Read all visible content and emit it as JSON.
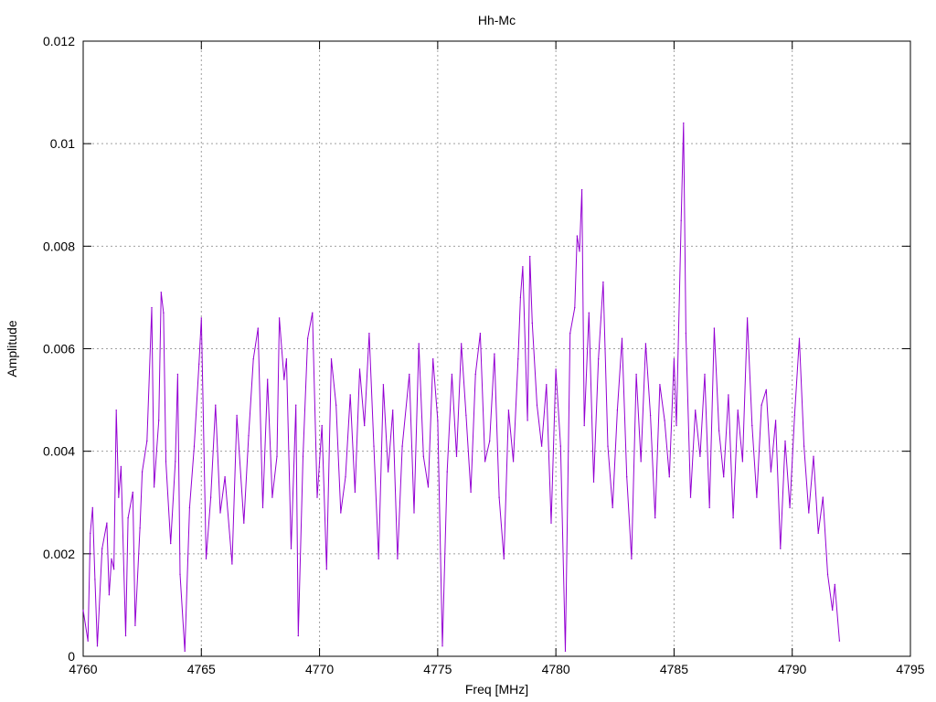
{
  "chart_data": {
    "type": "line",
    "title": "Hh-Mc",
    "xlabel": "Freq [MHz]",
    "ylabel": "Amplitude",
    "xlim": [
      4760,
      4795
    ],
    "ylim": [
      0,
      0.012
    ],
    "xticks": [
      4760,
      4765,
      4770,
      4775,
      4780,
      4785,
      4790,
      4795
    ],
    "yticks": [
      0,
      0.002,
      0.004,
      0.006,
      0.008,
      0.01,
      0.012
    ],
    "xtick_labels": [
      "4760",
      "4765",
      "4770",
      "4775",
      "4780",
      "4785",
      "4790",
      "4795"
    ],
    "ytick_labels": [
      "0",
      "0.002",
      "0.004",
      "0.006",
      "0.008",
      "0.01",
      "0.012"
    ],
    "grid": true,
    "series": [
      {
        "color": "#9400d3",
        "points": [
          [
            4760.0,
            0.0009
          ],
          [
            4760.2,
            0.0003
          ],
          [
            4760.3,
            0.0024
          ],
          [
            4760.4,
            0.0029
          ],
          [
            4760.5,
            0.0015
          ],
          [
            4760.6,
            0.0002
          ],
          [
            4760.8,
            0.0021
          ],
          [
            4761.0,
            0.0026
          ],
          [
            4761.1,
            0.0012
          ],
          [
            4761.2,
            0.0019
          ],
          [
            4761.3,
            0.0017
          ],
          [
            4761.4,
            0.0048
          ],
          [
            4761.5,
            0.0031
          ],
          [
            4761.6,
            0.0037
          ],
          [
            4761.8,
            0.0004
          ],
          [
            4761.9,
            0.0027
          ],
          [
            4762.1,
            0.0032
          ],
          [
            4762.2,
            0.0006
          ],
          [
            4762.4,
            0.0025
          ],
          [
            4762.5,
            0.0036
          ],
          [
            4762.7,
            0.0042
          ],
          [
            4762.9,
            0.0068
          ],
          [
            4763.0,
            0.0033
          ],
          [
            4763.2,
            0.0046
          ],
          [
            4763.3,
            0.0071
          ],
          [
            4763.4,
            0.0067
          ],
          [
            4763.5,
            0.0038
          ],
          [
            4763.7,
            0.0022
          ],
          [
            4763.9,
            0.0038
          ],
          [
            4764.0,
            0.0055
          ],
          [
            4764.1,
            0.0016
          ],
          [
            4764.3,
            0.0001
          ],
          [
            4764.5,
            0.0029
          ],
          [
            4764.7,
            0.0041
          ],
          [
            4764.9,
            0.0057
          ],
          [
            4765.0,
            0.0066
          ],
          [
            4765.2,
            0.0019
          ],
          [
            4765.4,
            0.0031
          ],
          [
            4765.6,
            0.0049
          ],
          [
            4765.8,
            0.0028
          ],
          [
            4766.0,
            0.0035
          ],
          [
            4766.3,
            0.0018
          ],
          [
            4766.5,
            0.0047
          ],
          [
            4766.8,
            0.0026
          ],
          [
            4767.0,
            0.0043
          ],
          [
            4767.2,
            0.0058
          ],
          [
            4767.4,
            0.0064
          ],
          [
            4767.6,
            0.0029
          ],
          [
            4767.8,
            0.0054
          ],
          [
            4768.0,
            0.0031
          ],
          [
            4768.2,
            0.0039
          ],
          [
            4768.3,
            0.0066
          ],
          [
            4768.5,
            0.0054
          ],
          [
            4768.6,
            0.0058
          ],
          [
            4768.8,
            0.0021
          ],
          [
            4769.0,
            0.0049
          ],
          [
            4769.1,
            0.0004
          ],
          [
            4769.3,
            0.0039
          ],
          [
            4769.5,
            0.0062
          ],
          [
            4769.7,
            0.0067
          ],
          [
            4769.9,
            0.0031
          ],
          [
            4770.1,
            0.0045
          ],
          [
            4770.3,
            0.0017
          ],
          [
            4770.5,
            0.0058
          ],
          [
            4770.7,
            0.0049
          ],
          [
            4770.9,
            0.0028
          ],
          [
            4771.1,
            0.0035
          ],
          [
            4771.3,
            0.0051
          ],
          [
            4771.5,
            0.0032
          ],
          [
            4771.7,
            0.0056
          ],
          [
            4771.9,
            0.0045
          ],
          [
            4772.1,
            0.0063
          ],
          [
            4772.3,
            0.0041
          ],
          [
            4772.5,
            0.0019
          ],
          [
            4772.7,
            0.0053
          ],
          [
            4772.9,
            0.0036
          ],
          [
            4773.1,
            0.0048
          ],
          [
            4773.3,
            0.0019
          ],
          [
            4773.5,
            0.0041
          ],
          [
            4773.8,
            0.0055
          ],
          [
            4774.0,
            0.0028
          ],
          [
            4774.2,
            0.0061
          ],
          [
            4774.4,
            0.0039
          ],
          [
            4774.6,
            0.0033
          ],
          [
            4774.8,
            0.0058
          ],
          [
            4775.0,
            0.0046
          ],
          [
            4775.2,
            0.0002
          ],
          [
            4775.4,
            0.0036
          ],
          [
            4775.6,
            0.0055
          ],
          [
            4775.8,
            0.0039
          ],
          [
            4776.0,
            0.0061
          ],
          [
            4776.2,
            0.0047
          ],
          [
            4776.4,
            0.0032
          ],
          [
            4776.6,
            0.0055
          ],
          [
            4776.8,
            0.0063
          ],
          [
            4777.0,
            0.0038
          ],
          [
            4777.2,
            0.0042
          ],
          [
            4777.4,
            0.0059
          ],
          [
            4777.6,
            0.0031
          ],
          [
            4777.8,
            0.0019
          ],
          [
            4778.0,
            0.0048
          ],
          [
            4778.2,
            0.0038
          ],
          [
            4778.4,
            0.0058
          ],
          [
            4778.5,
            0.007
          ],
          [
            4778.6,
            0.0076
          ],
          [
            4778.8,
            0.0046
          ],
          [
            4778.9,
            0.0078
          ],
          [
            4779.0,
            0.0065
          ],
          [
            4779.2,
            0.0049
          ],
          [
            4779.4,
            0.0041
          ],
          [
            4779.6,
            0.0053
          ],
          [
            4779.8,
            0.0026
          ],
          [
            4780.0,
            0.0056
          ],
          [
            4780.2,
            0.0041
          ],
          [
            4780.4,
            0.0001
          ],
          [
            4780.6,
            0.0063
          ],
          [
            4780.8,
            0.0068
          ],
          [
            4780.9,
            0.0082
          ],
          [
            4781.0,
            0.0079
          ],
          [
            4781.1,
            0.0091
          ],
          [
            4781.2,
            0.0045
          ],
          [
            4781.4,
            0.0067
          ],
          [
            4781.6,
            0.0034
          ],
          [
            4781.8,
            0.0058
          ],
          [
            4782.0,
            0.0073
          ],
          [
            4782.2,
            0.0041
          ],
          [
            4782.4,
            0.0029
          ],
          [
            4782.6,
            0.0048
          ],
          [
            4782.8,
            0.0062
          ],
          [
            4783.0,
            0.0035
          ],
          [
            4783.2,
            0.0019
          ],
          [
            4783.4,
            0.0055
          ],
          [
            4783.6,
            0.0038
          ],
          [
            4783.8,
            0.0061
          ],
          [
            4784.0,
            0.0047
          ],
          [
            4784.2,
            0.0027
          ],
          [
            4784.4,
            0.0053
          ],
          [
            4784.6,
            0.0046
          ],
          [
            4784.8,
            0.0035
          ],
          [
            4785.0,
            0.0058
          ],
          [
            4785.1,
            0.0045
          ],
          [
            4785.3,
            0.0085
          ],
          [
            4785.4,
            0.0104
          ],
          [
            4785.5,
            0.0063
          ],
          [
            4785.7,
            0.0031
          ],
          [
            4785.9,
            0.0048
          ],
          [
            4786.1,
            0.0039
          ],
          [
            4786.3,
            0.0055
          ],
          [
            4786.5,
            0.0029
          ],
          [
            4786.7,
            0.0064
          ],
          [
            4786.9,
            0.0044
          ],
          [
            4787.1,
            0.0035
          ],
          [
            4787.3,
            0.0051
          ],
          [
            4787.5,
            0.0027
          ],
          [
            4787.7,
            0.0048
          ],
          [
            4787.9,
            0.0038
          ],
          [
            4788.1,
            0.0066
          ],
          [
            4788.3,
            0.0045
          ],
          [
            4788.5,
            0.0031
          ],
          [
            4788.7,
            0.0049
          ],
          [
            4788.9,
            0.0052
          ],
          [
            4789.1,
            0.0036
          ],
          [
            4789.3,
            0.0046
          ],
          [
            4789.5,
            0.0021
          ],
          [
            4789.7,
            0.0042
          ],
          [
            4789.9,
            0.0029
          ],
          [
            4790.1,
            0.0047
          ],
          [
            4790.3,
            0.0062
          ],
          [
            4790.5,
            0.0041
          ],
          [
            4790.7,
            0.0028
          ],
          [
            4790.9,
            0.0039
          ],
          [
            4791.1,
            0.0024
          ],
          [
            4791.3,
            0.0031
          ],
          [
            4791.5,
            0.0016
          ],
          [
            4791.7,
            0.0009
          ],
          [
            4791.8,
            0.0014
          ],
          [
            4792.0,
            0.0003
          ]
        ]
      }
    ]
  }
}
